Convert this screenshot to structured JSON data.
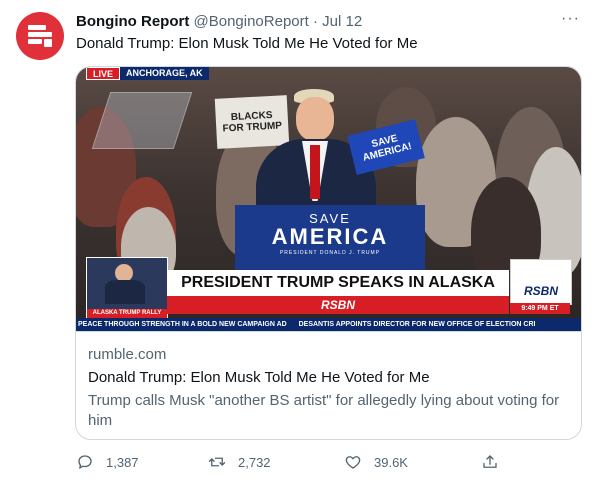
{
  "tweet": {
    "author_name": "Bongino Report",
    "handle": "@BonginoReport",
    "separator": "·",
    "date": "Jul 12",
    "more_label": "···",
    "text": "Donald Trump: Elon Musk Told Me He Voted for Me"
  },
  "video": {
    "live_label": "LIVE",
    "location": "ANCHORAGE, AK",
    "sign_text_1": "SAVE",
    "sign_text_2": "AMERICA",
    "podium_small": "PRESIDENT DONALD J. TRUMP",
    "crowd_sign": "SAVE AMERICA!",
    "crowd_sign_left": "BLACKS FOR TRUMP",
    "lower_third": "PRESIDENT TRUMP SPEAKS IN ALASKA",
    "brand": "RSBN",
    "brand_logo": "RSBN",
    "time": "9:49 PM ET",
    "inset_caption": "ALASKA TRUMP RALLY",
    "ticker_1": "PEACE THROUGH STRENGTH IN A BOLD NEW CAMPAIGN AD",
    "ticker_2": "DESANTIS APPOINTS DIRECTOR FOR NEW OFFICE OF ELECTION CRI"
  },
  "card": {
    "domain": "rumble.com",
    "title": "Donald Trump: Elon Musk Told Me He Voted for Me",
    "description": "Trump calls Musk \"another BS artist\" for allegedly lying about voting for him"
  },
  "actions": {
    "replies": "1,387",
    "retweets": "2,732",
    "likes": "39.6K"
  },
  "colors": {
    "avatar_bg": "#e0303a",
    "live_red": "#d81e25",
    "sign_blue": "#1b3a8c",
    "ticker_blue": "#0c2a6b"
  },
  "icons": [
    "newspaper-icon",
    "more-icon",
    "reply-icon",
    "retweet-icon",
    "like-icon",
    "share-icon"
  ]
}
